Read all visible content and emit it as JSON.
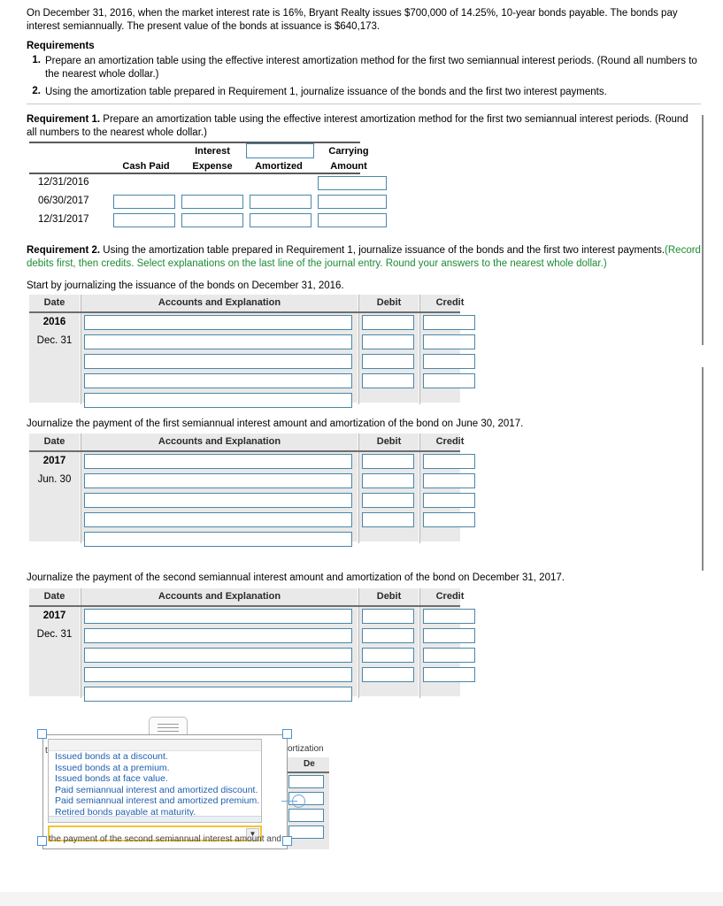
{
  "problem": {
    "statement": "On December 31, 2016, when the market interest rate is 16%, Bryant Realty issues $700,000 of 14.25%, 10-year bonds payable. The bonds pay interest semiannually. The present value of the bonds at issuance is $640,173.",
    "requirements_heading": "Requirements",
    "requirements": [
      {
        "num": "1.",
        "text": "Prepare an amortization table using the effective interest amortization method for the first two semiannual interest periods. (Round all numbers to the nearest whole dollar.)"
      },
      {
        "num": "2.",
        "text": "Using the amortization table prepared in Requirement 1, journalize issuance of the bonds and the first two interest payments."
      }
    ]
  },
  "requirement1": {
    "label": "Requirement 1.",
    "text": " Prepare an amortization table using the effective interest amortization method for the first two semiannual interest periods. (Round all numbers to the nearest whole dollar.)",
    "table": {
      "header_line1": {
        "interest": "Interest",
        "amortized_input_value": "",
        "carrying": "Carrying"
      },
      "header_line2": {
        "cash_paid": "Cash Paid",
        "expense": "Expense",
        "amortized": "Amortized",
        "amount": "Amount"
      },
      "rows": [
        {
          "date": "12/31/2016",
          "cash_paid": "",
          "interest_expense": "",
          "amortized": "",
          "carrying_amount": "",
          "has_first_three": false
        },
        {
          "date": "06/30/2017",
          "cash_paid": "",
          "interest_expense": "",
          "amortized": "",
          "carrying_amount": "",
          "has_first_three": true
        },
        {
          "date": "12/31/2017",
          "cash_paid": "",
          "interest_expense": "",
          "amortized": "",
          "carrying_amount": "",
          "has_first_three": true
        }
      ]
    }
  },
  "requirement2": {
    "label": "Requirement 2.",
    "text_black": " Using the amortization table prepared in Requirement 1, journalize issuance of the bonds and the first two interest payments.",
    "text_green": "(Record debits first, then credits. Select explanations on the last line of the journal entry. Round your answers to the nearest whole dollar.)",
    "green_color": "#1a8c33"
  },
  "journals": [
    {
      "prompt": "Start by journalizing the issuance of the bonds on December 31, 2016.",
      "columns": {
        "date": "Date",
        "accounts": "Accounts and Explanation",
        "debit": "Debit",
        "credit": "Credit"
      },
      "date_year": "2016",
      "date_day": "Dec. 31",
      "rows": [
        {
          "accounts": "",
          "debit": "",
          "credit": "",
          "has_amounts": true
        },
        {
          "accounts": "",
          "debit": "",
          "credit": "",
          "has_amounts": true
        },
        {
          "accounts": "",
          "debit": "",
          "credit": "",
          "has_amounts": true
        },
        {
          "accounts": "",
          "debit": "",
          "credit": "",
          "has_amounts": true
        },
        {
          "accounts": "",
          "debit": "",
          "credit": "",
          "has_amounts": false
        }
      ]
    },
    {
      "prompt": "Journalize the payment of the first semiannual interest amount and amortization of the bond on June 30, 2017.",
      "columns": {
        "date": "Date",
        "accounts": "Accounts and Explanation",
        "debit": "Debit",
        "credit": "Credit"
      },
      "date_year": "2017",
      "date_day": "Jun. 30",
      "rows": [
        {
          "accounts": "",
          "debit": "",
          "credit": "",
          "has_amounts": true
        },
        {
          "accounts": "",
          "debit": "",
          "credit": "",
          "has_amounts": true
        },
        {
          "accounts": "",
          "debit": "",
          "credit": "",
          "has_amounts": true
        },
        {
          "accounts": "",
          "debit": "",
          "credit": "",
          "has_amounts": true
        },
        {
          "accounts": "",
          "debit": "",
          "credit": "",
          "has_amounts": false
        }
      ]
    },
    {
      "prompt": "Journalize the payment of the second semiannual interest amount and amortization of the bond on December 31, 2017.",
      "columns": {
        "date": "Date",
        "accounts": "Accounts and Explanation",
        "debit": "Debit",
        "credit": "Credit"
      },
      "date_year": "2017",
      "date_day": "Dec. 31",
      "rows": [
        {
          "accounts": "",
          "debit": "",
          "credit": "",
          "has_amounts": true
        },
        {
          "accounts": "",
          "debit": "",
          "credit": "",
          "has_amounts": true
        },
        {
          "accounts": "",
          "debit": "",
          "credit": "",
          "has_amounts": true
        },
        {
          "accounts": "",
          "debit": "",
          "credit": "",
          "has_amounts": true
        },
        {
          "accounts": "",
          "debit": "",
          "credit": "",
          "has_amounts": false
        }
      ]
    }
  ],
  "dropdown_overlay": {
    "options": [
      "Issued bonds at a discount.",
      "Issued bonds at a premium.",
      "Issued bonds at face value.",
      "Paid semiannual interest and amortized discount.",
      "Paid semiannual interest and amortized premium.",
      "Retired bonds payable at maturity."
    ],
    "combo_value": "",
    "combo_arrow": "▼",
    "option_color": "#1f5fb0",
    "combo_border_color": "#f2c42e",
    "behind_text_left": "t",
    "behind_text_right": "ortization",
    "behind_debit_label": "De",
    "behind_bottom_text": "the payment of the second semiannual interest amount and amortiz"
  }
}
